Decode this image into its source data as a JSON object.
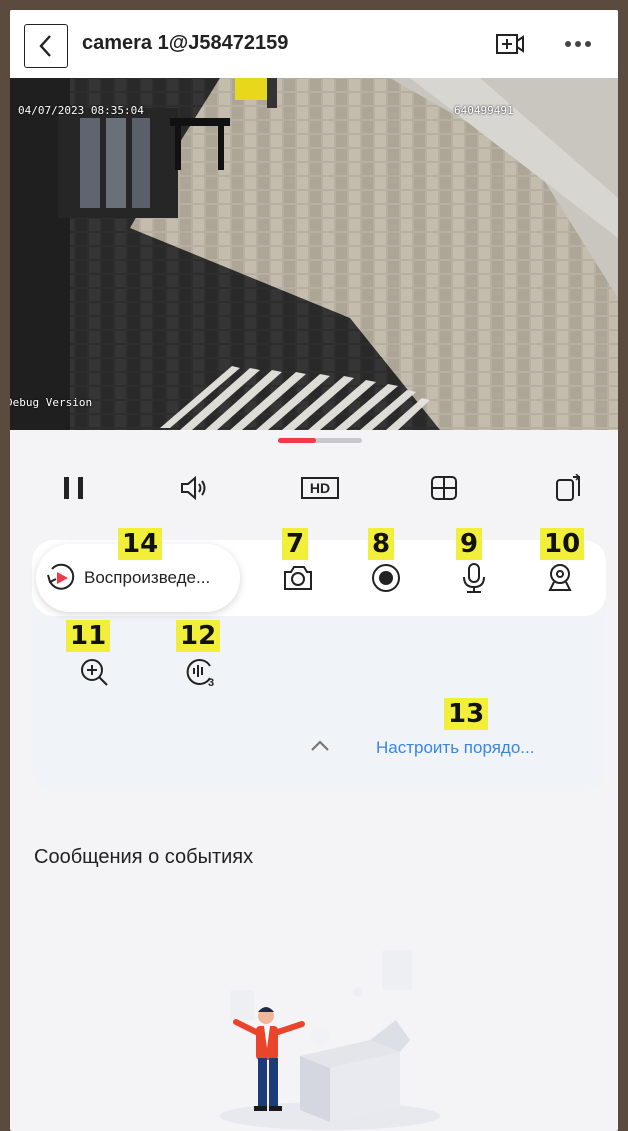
{
  "header": {
    "title": "camera 1@J58472159",
    "back_icon": "chevron-left-icon",
    "add_camera_icon": "video-add-icon",
    "more_icon": "more-dots-icon"
  },
  "video": {
    "timestamp": "04/07/2023 08:35:04",
    "code": "640499491",
    "debug_label": "Debug Version"
  },
  "stream": {
    "progress_fraction": 0.45,
    "accent": "#ef3b46"
  },
  "controls": [
    {
      "icon": "pause-icon"
    },
    {
      "icon": "volume-icon"
    },
    {
      "icon": "hd-icon",
      "label": "HD"
    },
    {
      "icon": "grid-split-icon"
    },
    {
      "icon": "rotate-screen-icon"
    }
  ],
  "tools": {
    "playback_label": "Воспроизведе...",
    "playback_icon": "playback-icon",
    "customize_label": "Настроить порядо...",
    "collapse_icon": "chevron-up-icon"
  },
  "badges": {
    "b14": "14",
    "b7": "7",
    "b8": "8",
    "b9": "9",
    "b10": "10",
    "b11": "11",
    "b12": "12",
    "b13": "13"
  },
  "events": {
    "title": "Сообщения о событиях"
  },
  "colors": {
    "badge": "#f1ef3a",
    "link": "#3a86e0",
    "playback_red": "#ef3b46"
  }
}
